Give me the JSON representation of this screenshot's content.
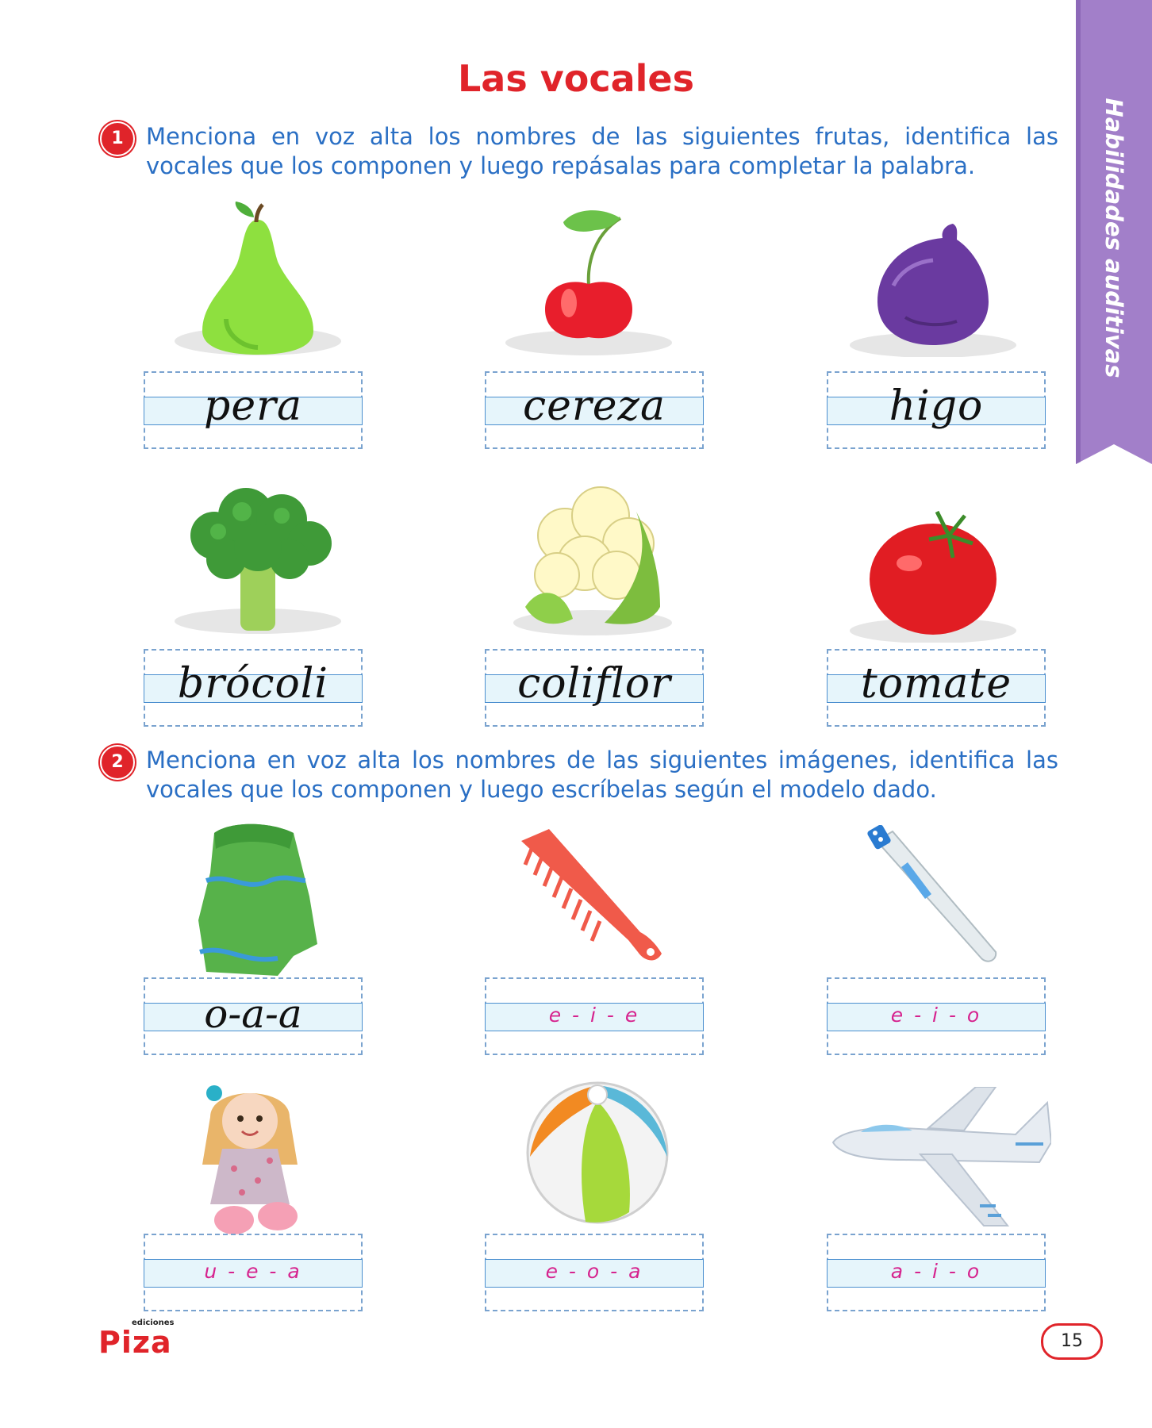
{
  "page": {
    "title": "Las vocales",
    "side_tab": "Habilidades auditivas",
    "page_number": "15",
    "publisher": {
      "small": "ediciones",
      "big": "Piza"
    }
  },
  "exercise1": {
    "number": "1",
    "line1": "Menciona en voz alta los nombres de las siguientes frutas, identifica las",
    "line2": "vocales que los componen y luego repásalas para completar la palabra.",
    "items": [
      {
        "picture": "pear",
        "word": "pera"
      },
      {
        "picture": "cherry",
        "word": "cereza"
      },
      {
        "picture": "fig",
        "word": "higo"
      },
      {
        "picture": "broccoli",
        "word": "brócoli"
      },
      {
        "picture": "cauliflower",
        "word": "coliflor"
      },
      {
        "picture": "tomato",
        "word": "tomate"
      }
    ]
  },
  "exercise2": {
    "number": "2",
    "line1": "Menciona en voz alta los nombres de las siguientes imágenes, identifica las",
    "line2": "vocales que los componen y luego escríbelas según el modelo dado.",
    "items": [
      {
        "picture": "towel",
        "vowels": "o-a-a"
      },
      {
        "picture": "comb",
        "vowels": "e - i - e"
      },
      {
        "picture": "toothbrush",
        "vowels": "e - i - o"
      },
      {
        "picture": "doll",
        "vowels": "u - e - a"
      },
      {
        "picture": "beach-ball",
        "vowels": "e - o - a"
      },
      {
        "picture": "airplane",
        "vowels": "a - i - o"
      }
    ]
  },
  "colors": {
    "title": "#e0242a",
    "instruction": "#2a6fc4",
    "tab": "#a27fc9",
    "vowels": "#d6238e"
  }
}
